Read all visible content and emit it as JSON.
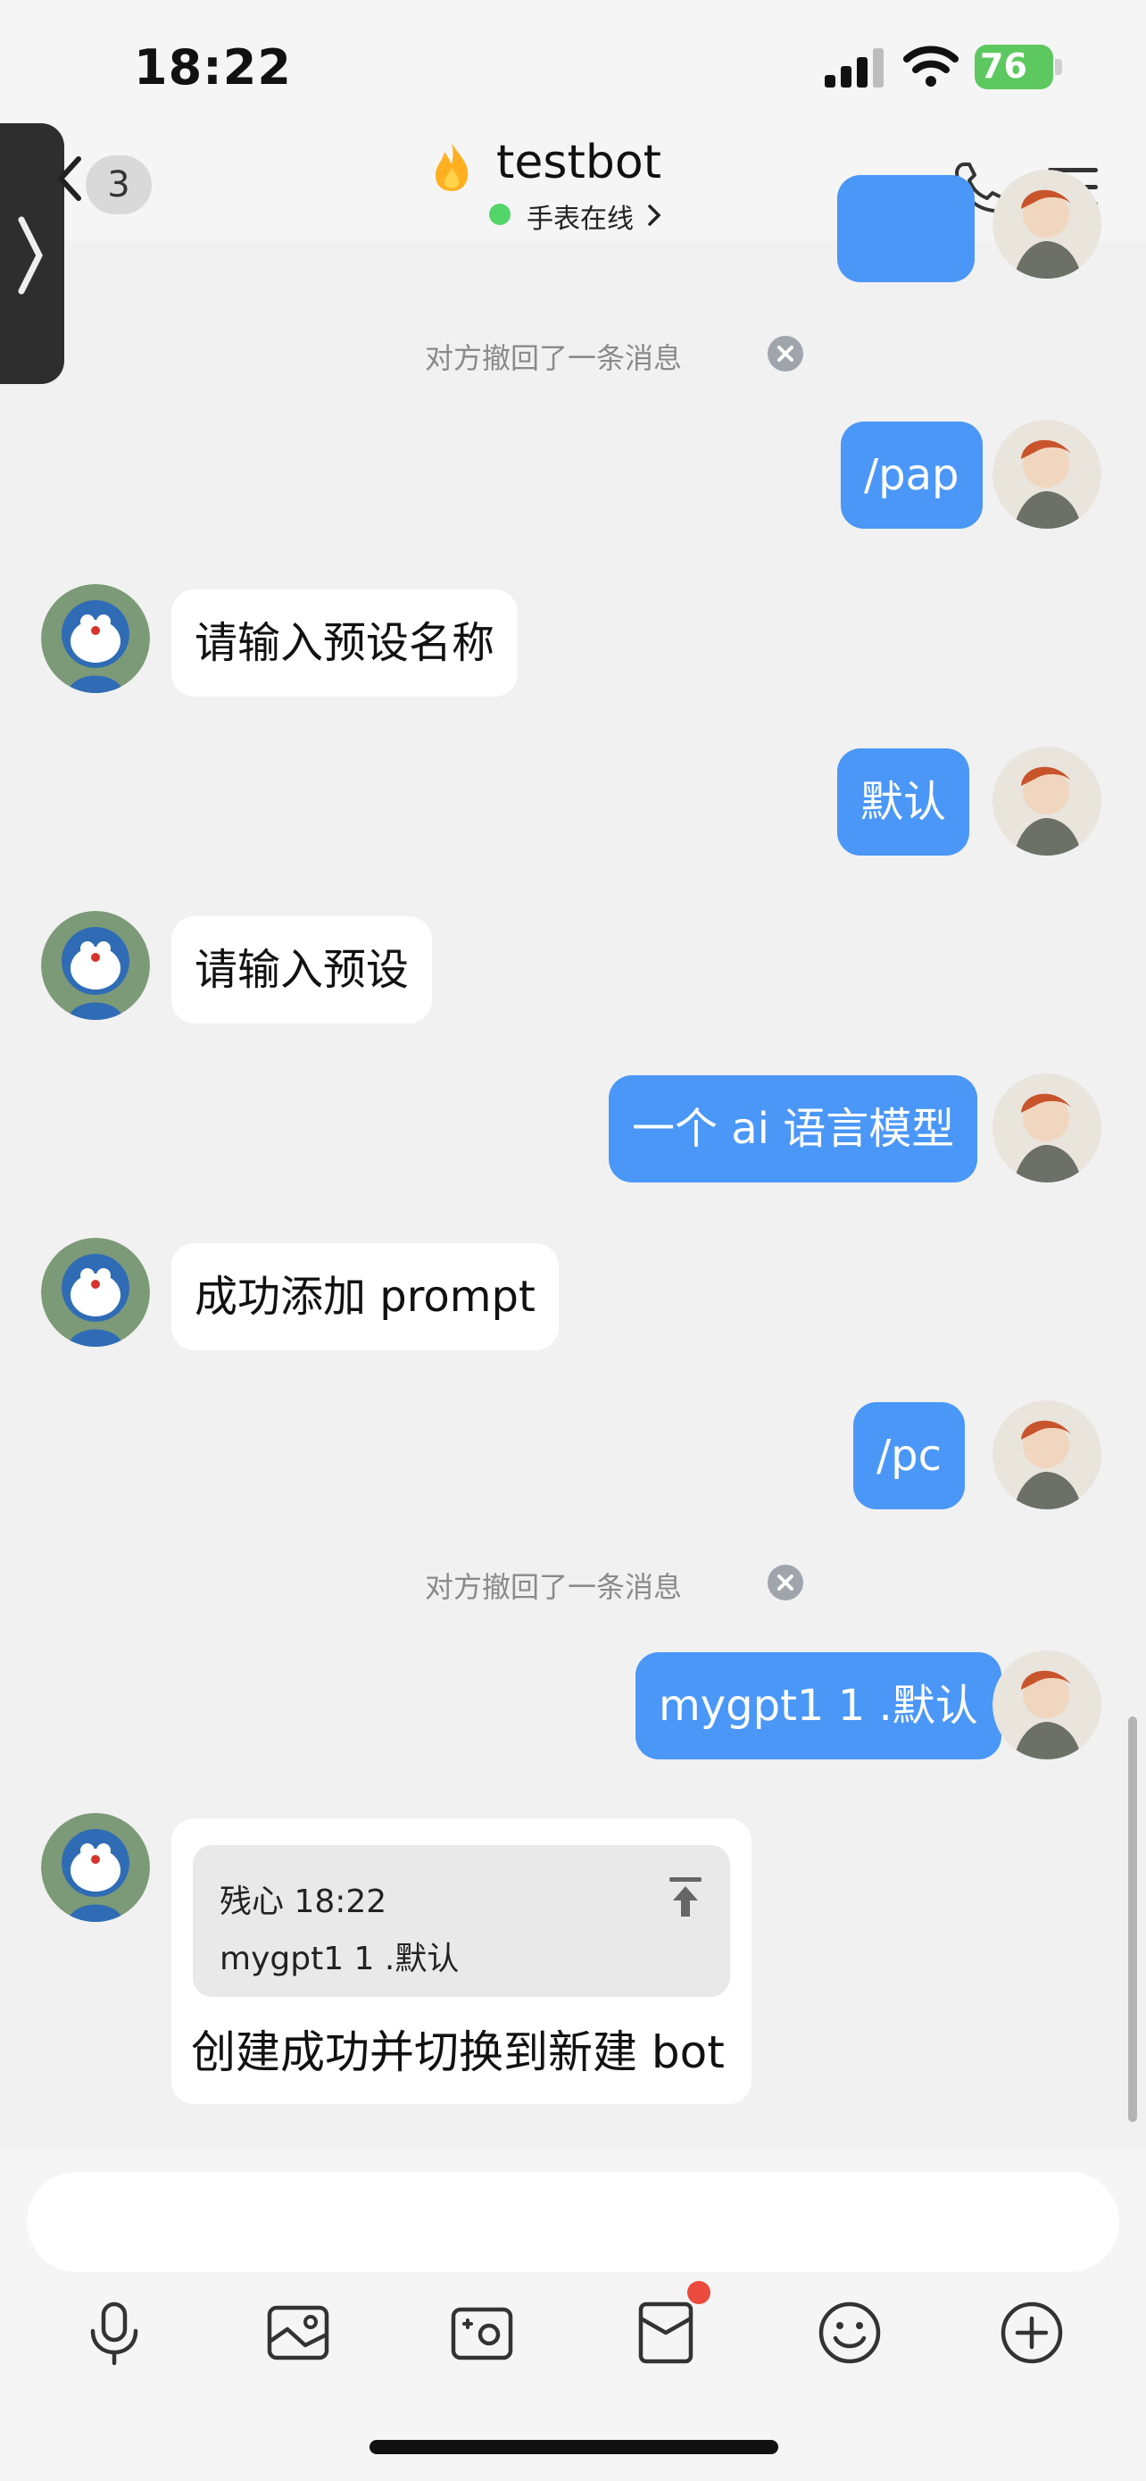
{
  "status_bar": {
    "time": "18:22",
    "battery": "76"
  },
  "header": {
    "unread_count": "3",
    "title": "testbot",
    "presence": "手表在线",
    "accent_color": "#4a97f7"
  },
  "messages": {
    "recall_1": "对方撤回了一条消息",
    "m1": "/pap",
    "m2": "请输入预设名称",
    "m3": "默认",
    "m4": "请输入预设",
    "m5": "一个 ai 语言模型",
    "m6": "成功添加 prompt",
    "m7": "/pc",
    "recall_2": "对方撤回了一条消息",
    "m8": "mygpt1 1 .默认",
    "quote": {
      "author_time": "残心 18:22",
      "text": "mygpt1 1 .默认",
      "reply": "创建成功并切换到新建 bot"
    }
  },
  "input": {
    "value": ""
  },
  "toolbar": {
    "icons": [
      "microphone-icon",
      "image-icon",
      "camera-icon",
      "red-packet-icon",
      "emoji-icon",
      "plus-icon"
    ]
  }
}
